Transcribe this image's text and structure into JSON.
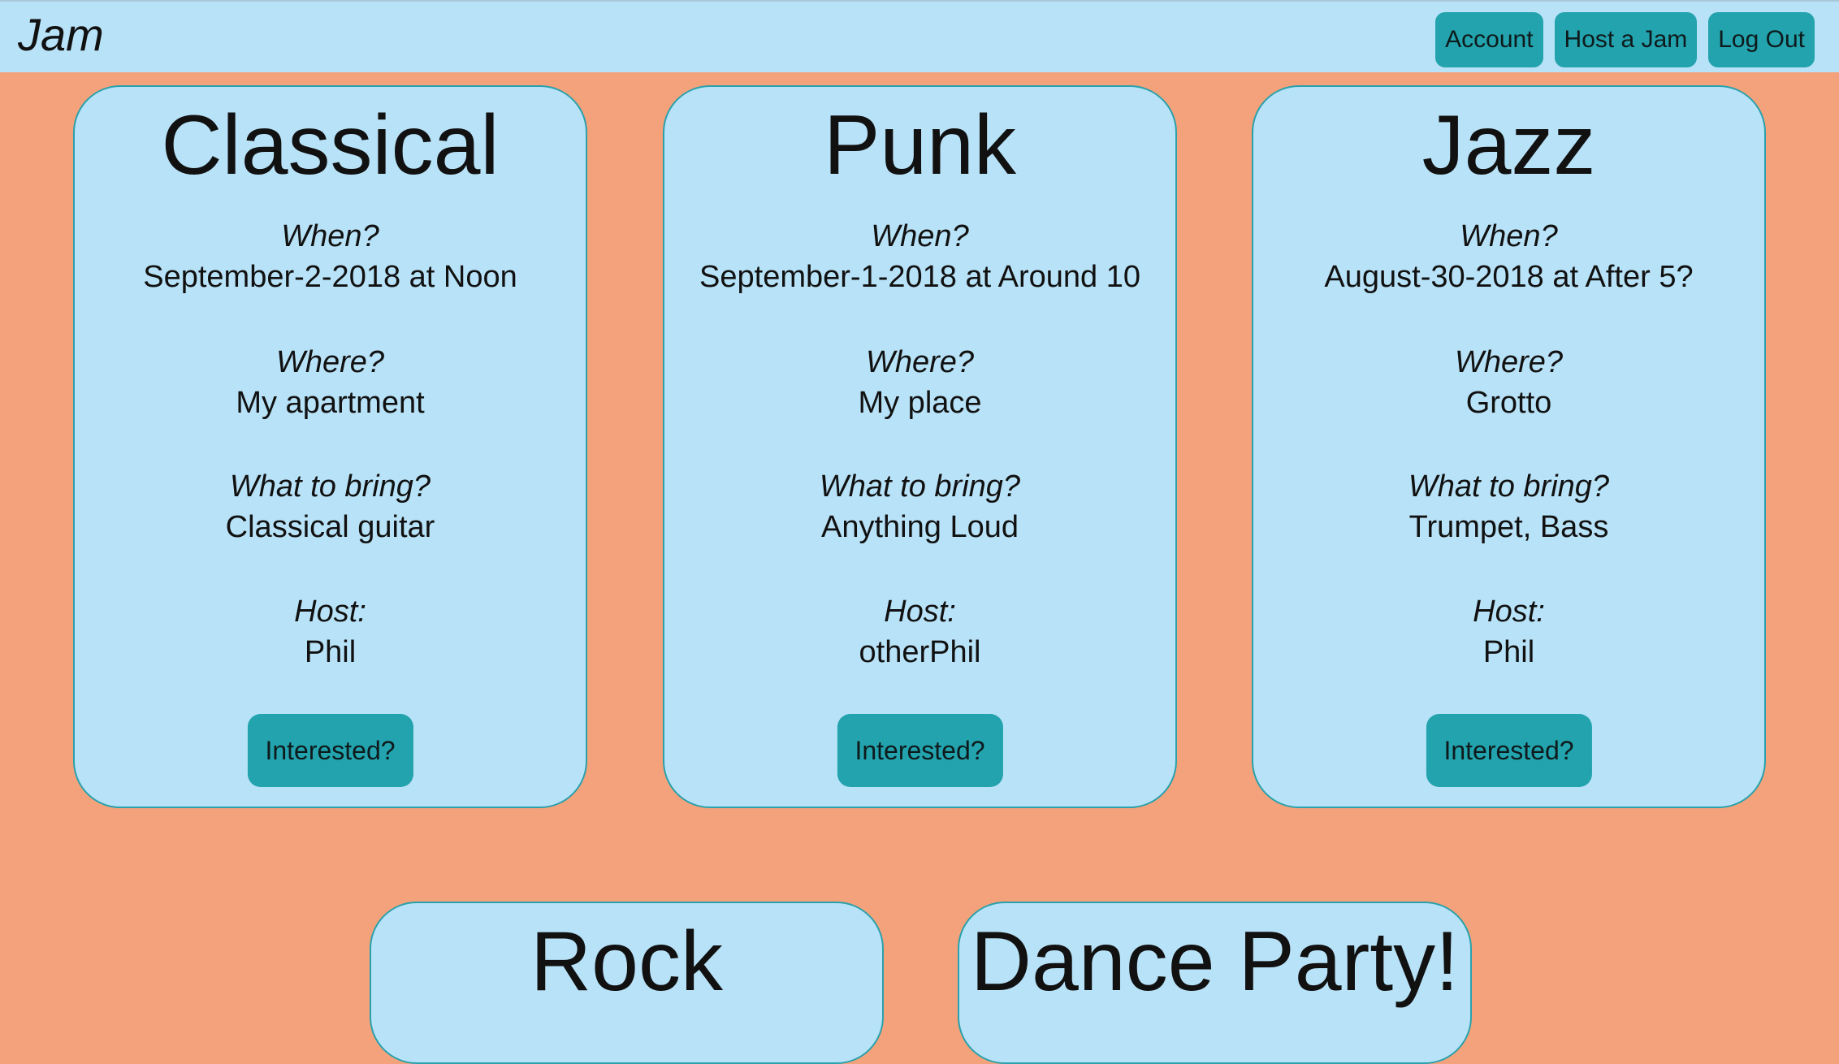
{
  "navbar": {
    "brand": "Jam",
    "buttons": [
      "Account",
      "Host a Jam",
      "Log Out"
    ]
  },
  "labels": {
    "when": "When?",
    "where": "Where?",
    "bring": "What to bring?",
    "host": "Host:",
    "interested": "Interested?"
  },
  "jams": [
    {
      "title": "Classical",
      "when": "September-2-2018 at Noon",
      "where": "My apartment",
      "bring": "Classical guitar",
      "host": "Phil"
    },
    {
      "title": "Punk",
      "when": "September-1-2018 at Around 10",
      "where": "My place",
      "bring": "Anything Loud",
      "host": "otherPhil"
    },
    {
      "title": "Jazz",
      "when": "August-30-2018 at After 5?",
      "where": "Grotto",
      "bring": "Trumpet, Bass",
      "host": "Phil"
    },
    {
      "title": "Rock"
    },
    {
      "title": "Dance Party!"
    }
  ]
}
